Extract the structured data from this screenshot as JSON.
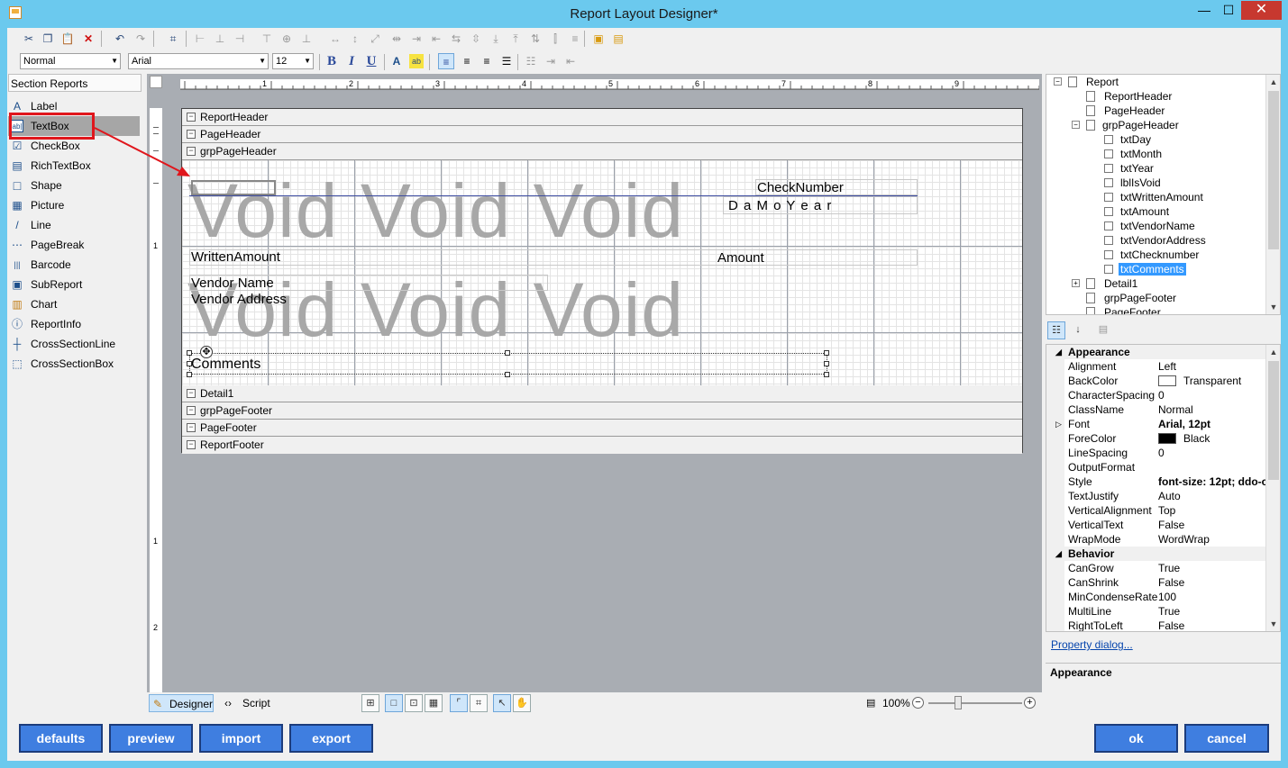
{
  "window": {
    "title": "Report Layout Designer*",
    "min": "—",
    "max": "☐",
    "close": "✕"
  },
  "toolbar": {
    "style_combo": "Normal",
    "font_combo": "Arial",
    "size_combo": "12",
    "bold": "B",
    "italic": "I",
    "underline": "U"
  },
  "toolbox": {
    "header": "Section Reports",
    "items": [
      {
        "label": "Label",
        "icon": "A"
      },
      {
        "label": "TextBox",
        "icon": "ab|"
      },
      {
        "label": "CheckBox",
        "icon": "☑"
      },
      {
        "label": "RichTextBox",
        "icon": "▤"
      },
      {
        "label": "Shape",
        "icon": "□"
      },
      {
        "label": "Picture",
        "icon": "▦"
      },
      {
        "label": "Line",
        "icon": "/"
      },
      {
        "label": "PageBreak",
        "icon": "⋯"
      },
      {
        "label": "Barcode",
        "icon": "|||"
      },
      {
        "label": "SubReport",
        "icon": "▣"
      },
      {
        "label": "Chart",
        "icon": "▥"
      },
      {
        "label": "ReportInfo",
        "icon": "ⓘ"
      },
      {
        "label": "CrossSectionLine",
        "icon": "┼"
      },
      {
        "label": "CrossSectionBox",
        "icon": "⬚"
      }
    ]
  },
  "ruler": {
    "marks": [
      "1",
      "2",
      "3",
      "4",
      "5",
      "6",
      "7",
      "8",
      "9"
    ],
    "vmarks": [
      "1",
      "1",
      "2"
    ]
  },
  "report": {
    "bands": {
      "report_header": "ReportHeader",
      "page_header": "PageHeader",
      "grp_page_header": "grpPageHeader",
      "detail": "Detail1",
      "grp_page_footer": "grpPageFooter",
      "page_footer": "PageFooter",
      "report_footer": "ReportFooter"
    },
    "void_text_1": "Void Void Void",
    "void_text_2": "Void Void Void",
    "fields": {
      "check_number": "CheckNumber",
      "day_month_year": "D a M o Y e a r",
      "written_amount": "WrittenAmount",
      "amount": "Amount",
      "vendor_name": "Vendor Name",
      "vendor_address": "Vendor Address",
      "comments": "Comments"
    }
  },
  "designer_strip": {
    "designer_tab": "Designer",
    "script_tab": "Script",
    "zoom": "100%"
  },
  "tree": {
    "items": [
      {
        "label": "Report"
      },
      {
        "label": "ReportHeader"
      },
      {
        "label": "PageHeader"
      },
      {
        "label": "grpPageHeader"
      },
      {
        "label": "txtDay"
      },
      {
        "label": "txtMonth"
      },
      {
        "label": "txtYear"
      },
      {
        "label": "lblIsVoid"
      },
      {
        "label": "txtWrittenAmount"
      },
      {
        "label": "txtAmount"
      },
      {
        "label": "txtVendorName"
      },
      {
        "label": "txtVendorAddress"
      },
      {
        "label": "txtChecknumber"
      },
      {
        "label": "txtComments"
      },
      {
        "label": "Detail1"
      },
      {
        "label": "grpPageFooter"
      },
      {
        "label": "PageFooter"
      }
    ]
  },
  "properties": {
    "rows": [
      {
        "name": "Appearance",
        "value": "",
        "category": true
      },
      {
        "name": "Alignment",
        "value": "Left"
      },
      {
        "name": "BackColor",
        "value": "Transparent",
        "swatch": "#ffffff"
      },
      {
        "name": "CharacterSpacing",
        "value": "0"
      },
      {
        "name": "ClassName",
        "value": "Normal"
      },
      {
        "name": "Font",
        "value": "Arial, 12pt",
        "bold": true
      },
      {
        "name": "ForeColor",
        "value": "Black",
        "swatch": "#000000"
      },
      {
        "name": "LineSpacing",
        "value": "0"
      },
      {
        "name": "OutputFormat",
        "value": ""
      },
      {
        "name": "Style",
        "value": "font-size: 12pt; ddo-c",
        "bold": true
      },
      {
        "name": "TextJustify",
        "value": "Auto"
      },
      {
        "name": "VerticalAlignment",
        "value": "Top"
      },
      {
        "name": "VerticalText",
        "value": "False"
      },
      {
        "name": "WrapMode",
        "value": "WordWrap"
      },
      {
        "name": "Behavior",
        "value": "",
        "category": true
      },
      {
        "name": "CanGrow",
        "value": "True"
      },
      {
        "name": "CanShrink",
        "value": "False"
      },
      {
        "name": "MinCondenseRate",
        "value": "100"
      },
      {
        "name": "MultiLine",
        "value": "True"
      },
      {
        "name": "RightToLeft",
        "value": "False"
      }
    ],
    "link": "Property dialog...",
    "description_title": "Appearance"
  },
  "buttons": {
    "defaults": "defaults",
    "preview": "preview",
    "import": "import",
    "export": "export",
    "ok": "ok",
    "cancel": "cancel"
  },
  "colors": {
    "frame": "#6bc9ee",
    "button_fill": "#3f7ee0",
    "selection": "#3399ff",
    "highlight_box": "#e0161c"
  }
}
